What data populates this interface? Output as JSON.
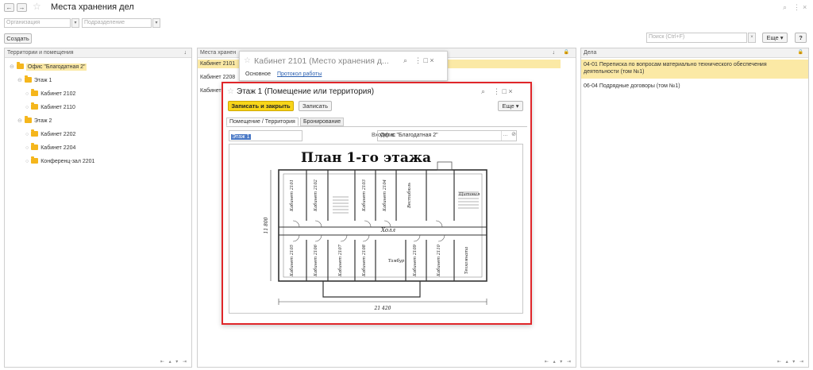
{
  "window": {
    "title": "Места хранения дел",
    "back": "←",
    "forward": "→",
    "star": "☆",
    "link_icon": "⌕",
    "more_icon": "⋮",
    "close_icon": "×"
  },
  "filters": {
    "organization_placeholder": "Организация",
    "subdivision_placeholder": "Подразделение",
    "dropdown": "▾"
  },
  "toolbar": {
    "create_label": "Создать",
    "search_placeholder": "Поиск (Ctrl+F)",
    "search_clear": "×",
    "more_label": "Еще ▾",
    "help_label": "?"
  },
  "left_panel": {
    "header": "Территории и помещения",
    "sort_icon": "↓",
    "items": [
      {
        "label": "Офис \"Благодатная 2\"",
        "level": 0,
        "expander": "⊖",
        "selected": true
      },
      {
        "label": "Этаж 1",
        "level": 1,
        "expander": "⊖"
      },
      {
        "label": "Кабинет 2102",
        "level": 2,
        "expander": "○"
      },
      {
        "label": "Кабинет 2110",
        "level": 2,
        "expander": "○"
      },
      {
        "label": "Этаж 2",
        "level": 1,
        "expander": "⊖"
      },
      {
        "label": "Кабинет 2202",
        "level": 2,
        "expander": "○"
      },
      {
        "label": "Кабинет 2204",
        "level": 2,
        "expander": "○"
      },
      {
        "label": "Конференц-зал 2201",
        "level": 2,
        "expander": "○"
      }
    ],
    "pager": "⇤ ▴ ▾ ⇥"
  },
  "middle_panel": {
    "header": "Места хранен",
    "sort_icon": "↓",
    "lock_icon": "🔒",
    "rows": [
      "Кабинет 2101",
      "Кабинет 2208",
      "Кабинет"
    ],
    "pager": "⇤ ▴ ▾ ⇥"
  },
  "right_panel": {
    "header": "Дела",
    "lock_icon": "🔒",
    "rows": [
      {
        "text": "04-01 Переписка по вопросам материально технического обеспечения деятельности (том №1)",
        "selected": true
      },
      {
        "text": "06-04 Подрядные договоры (том №1)",
        "selected": false
      }
    ],
    "pager": "⇤ ▴ ▾ ⇥"
  },
  "back_window": {
    "title": "Кабинет 2101 (Место хранения д...",
    "tab_main": "Основное",
    "tab_protocol": "Протокол работы",
    "controls": "⋮  □  ×"
  },
  "modal": {
    "title": "Этаж 1 (Помещение или территория)",
    "controls": "⋮  □  ×",
    "save_close": "Записать и закрыть",
    "save": "Записать",
    "more": "Еще ▾",
    "tab_room": "Помещение / Территория",
    "tab_booking": "Бронирование",
    "name_value": "Этаж 1",
    "parent_label": "Входит в:",
    "parent_value": "Офис \"Благодатная 2\"",
    "parent_btn": "...",
    "parent_link": "⊘"
  },
  "floor_plan": {
    "title": "План 1-го этажа",
    "rooms_top": [
      "Кабинет 2101",
      "Кабинет 2102",
      "Кабинет 2103",
      "Кабинет 2104",
      "Вестибюль",
      "Щитовая"
    ],
    "rooms_bottom": [
      "Кабинет 2105",
      "Кабинет 2106",
      "Кабинет 2107",
      "Кабинет 2108",
      "Холл",
      "Тамбур",
      "Кабинет 2109",
      "Кабинет 2110",
      "Техкомната"
    ],
    "dim_height": "11 800",
    "dim_width": "21 420"
  },
  "colors": {
    "accent_yellow": "#f8d51a",
    "selection": "#fbe9a5",
    "highlight_border": "#e0262a",
    "link": "#2a5fb0"
  }
}
